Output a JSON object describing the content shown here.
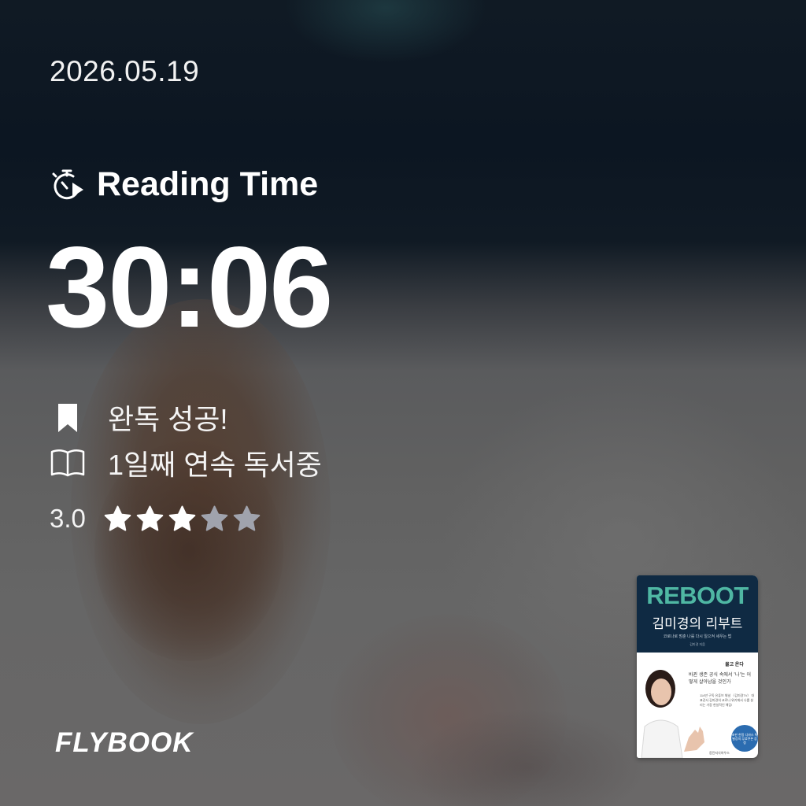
{
  "date": "2026.05.19",
  "reading": {
    "title": "Reading Time",
    "icon": "stopwatch-play-icon",
    "time": "30:06"
  },
  "status": [
    {
      "icon": "bookmark-icon",
      "text": "완독 성공!"
    },
    {
      "icon": "open-book-icon",
      "text": "1일째 연속 독서중"
    }
  ],
  "rating": {
    "value_text": "3.0",
    "value": 3,
    "max": 5
  },
  "brand": "FLYBOOK",
  "book": {
    "cover_title_en": "REBOOT",
    "cover_title_ko": "김미경의 리부트",
    "cover_subtitle": "코로나로 멈춘 나를 다시 일으켜 세우는 법",
    "cover_author": "김미경 지음",
    "cover_tagline": "코로나 2차 쇼크가 실직, 폐업, 파산을 몰고 온다",
    "cover_quote": "바뀐 생존 공식 속에서 '나'는 어떻게 살아남을 것인가",
    "cover_blurb": "114만 구독 유튜브 채널 〈김미경TV〉 대표강사 김미경의 코로나 위기에서 나를 살리는 가장 현실적인 해답!",
    "cover_badge": "초판 한정 디바스 특별강의 무료쿠폰 증정",
    "cover_publisher": "웅진지식하우스"
  },
  "colors": {
    "star_filled": "#ffffff",
    "star_empty": "#a0a3ad",
    "cover_navy": "#0f2a43",
    "cover_teal": "#4fb7a3",
    "badge_blue": "#2b6cb0"
  }
}
